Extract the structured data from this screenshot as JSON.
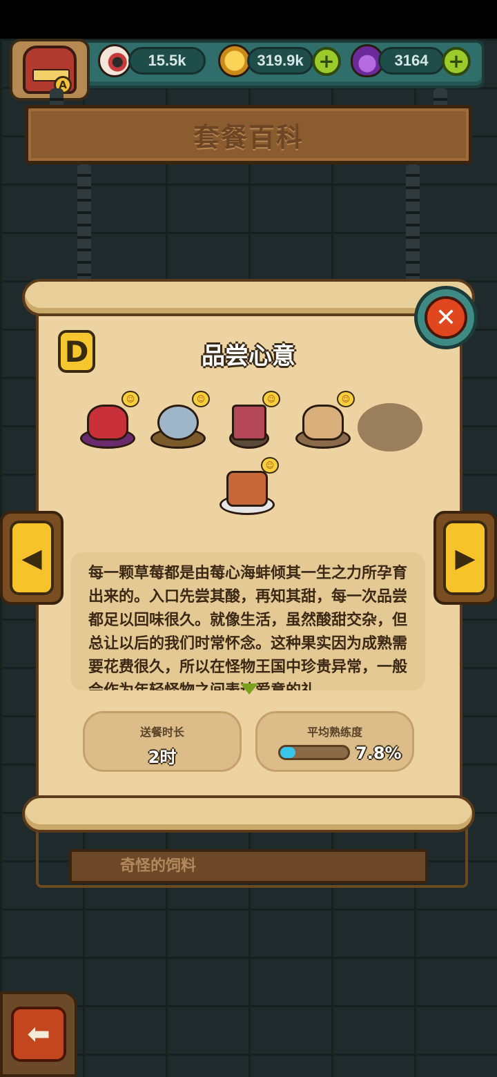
{
  "currency": {
    "eyes": "15.5k",
    "coins": "319.9k",
    "potions": "3164",
    "plus_label": "+"
  },
  "avatar": {
    "rank": "A"
  },
  "page_title": "套餐百科",
  "card": {
    "grade": "D",
    "title": "品尝心意",
    "close_label": "✕",
    "prev_label": "◀",
    "next_label": "▶",
    "description": "每一颗草莓都是由莓心海蚌倾其一生之力所孕育出来的。入口先尝其酸，再知其甜，每一次品尝都足以回味很久。就像生活，虽然酸甜交杂，但总让以后的我们时常怀念。这种果实因为成熟需要花费很久，所以在怪物王国中珍贵异常，一般会作为年轻怪物之间表达爱意的礼",
    "stats": {
      "delivery_label": "送餐时长",
      "delivery_value": "2时",
      "proficiency_label": "平均熟练度",
      "proficiency_value": "7.8%",
      "proficiency_fraction": 0.078
    }
  },
  "next_card_title": "奇怪的饲料",
  "back_label": "⬅",
  "colors": {
    "accent_teal": "#2f6e6a",
    "parchment": "#ecd3a1",
    "button_yellow": "#f6c42a",
    "close_red": "#e0471f",
    "progress_blue": "#39c6ea"
  }
}
